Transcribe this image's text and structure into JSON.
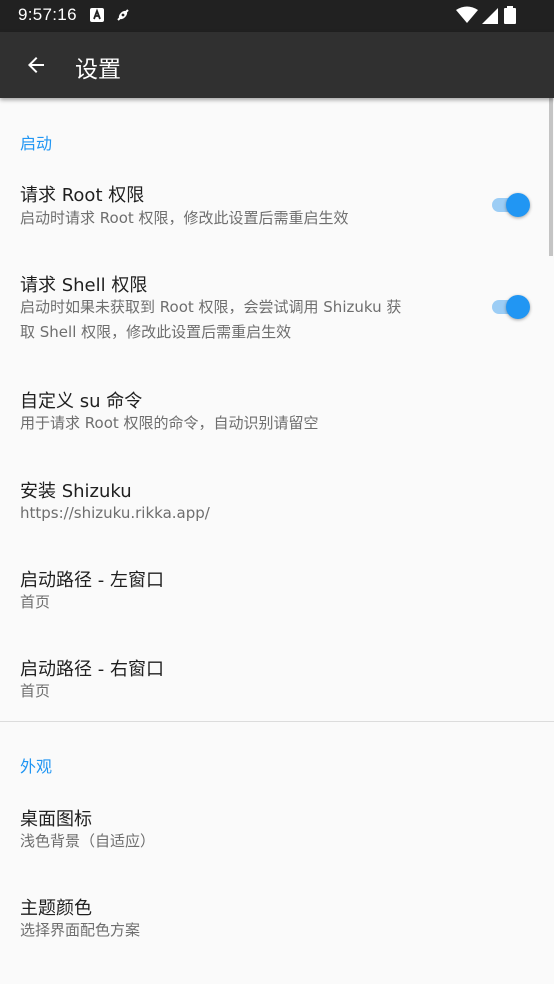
{
  "status_bar": {
    "time": "9:57:16"
  },
  "app_bar": {
    "title": "设置"
  },
  "sections": [
    {
      "header": "启动",
      "items": [
        {
          "title": "请求 Root 权限",
          "summary": "启动时请求 Root 权限，修改此设置后需重启生效",
          "switch_on": true
        },
        {
          "title": "请求 Shell 权限",
          "summary_lines": [
            "启动时如果未获取到 Root 权限，会尝试调用 Shizuku 获",
            "取 Shell 权限，修改此设置后需重启生效"
          ],
          "switch_on": true
        },
        {
          "title": "自定义 su 命令",
          "summary": "用于请求 Root 权限的命令，自动识别请留空"
        },
        {
          "title": "安装 Shizuku",
          "summary": "https://shizuku.rikka.app/"
        },
        {
          "title": "启动路径 - 左窗口",
          "summary": "首页"
        },
        {
          "title": "启动路径 - 右窗口",
          "summary": "首页"
        }
      ]
    },
    {
      "header": "外观",
      "items": [
        {
          "title": "桌面图标",
          "summary": "浅色背景（自适应）"
        },
        {
          "title": "主题颜色",
          "summary": "选择界面配色方案"
        }
      ]
    }
  ],
  "colors": {
    "accent": "#2196f3",
    "status_bar": "#212121",
    "app_bar": "#303030",
    "background": "#fafafa"
  }
}
